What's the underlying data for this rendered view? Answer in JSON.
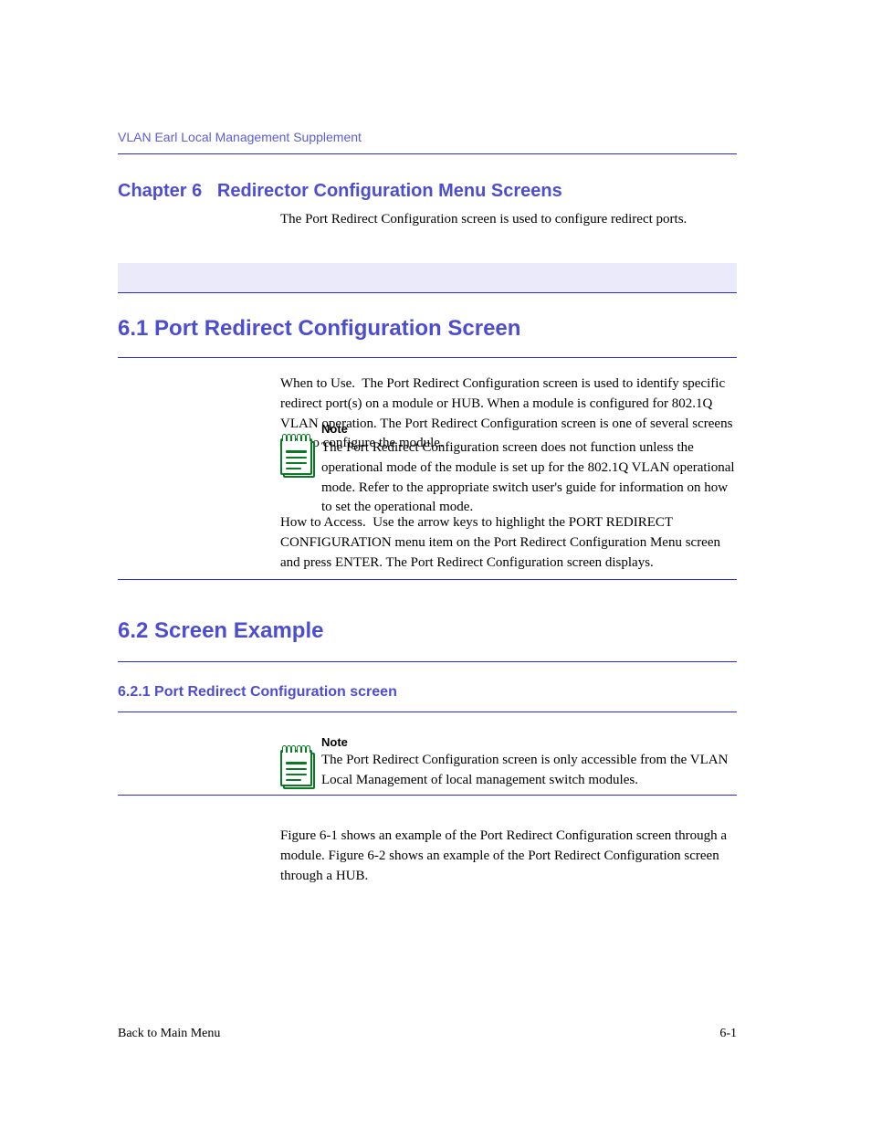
{
  "header": {
    "running": "VLAN Earl Local Management Supplement"
  },
  "chapter": {
    "number": "Chapter 6",
    "title": "Redirector Configuration Menu Screens",
    "intro": "The Port Redirect Configuration screen is used to configure redirect ports."
  },
  "section1": {
    "title": "6.1  Port Redirect Configuration Screen",
    "p1": "When to Use.  The Port Redirect Configuration screen is used to identify specific redirect port(s) on a module or HUB. When a module is configured for 802.1Q VLAN operation. The Port Redirect Configuration screen is one of several screens used to configure the module.",
    "note_label": "Note",
    "note": "The Port Redirect Configuration screen does not function unless the operational mode of the module is set up for the 802.1Q VLAN operational mode. Refer to the appropriate switch user's guide for information on how to set the operational mode.",
    "p2": "How to Access.  Use the arrow keys to highlight the PORT REDIRECT CONFIGURATION menu item on the Port Redirect Configuration Menu screen and press ENTER. The Port Redirect Configuration screen displays."
  },
  "section2": {
    "title": "6.2  Screen Example",
    "sub": "6.2.1  Port Redirect Configuration screen",
    "note_label": "Note",
    "note": "The Port Redirect Configuration screen is only accessible from the VLAN Local Management of local management switch modules.",
    "p3": "Figure 6-1 shows an example of the Port Redirect Configuration screen through a module. Figure 6-2 shows an example of the Port Redirect Configuration screen through a HUB."
  },
  "footer": {
    "left": "Back to Main Menu",
    "right": "6-1"
  }
}
